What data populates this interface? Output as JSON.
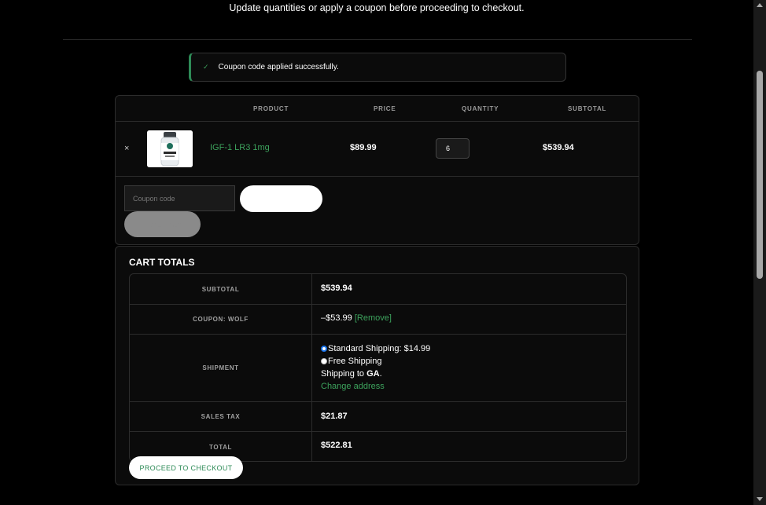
{
  "intro_text": "Update quantities or apply a coupon before proceeding to checkout.",
  "notice": {
    "text": "Coupon code applied successfully.",
    "icon": "check-icon",
    "accent_color": "#2e8b57"
  },
  "cart": {
    "headers": {
      "product": "PRODUCT",
      "price": "PRICE",
      "quantity": "QUANTITY",
      "subtotal": "SUBTOTAL"
    },
    "item": {
      "remove_symbol": "×",
      "name": "IGF-1 LR3 1mg",
      "price": "$89.99",
      "quantity": "6",
      "subtotal": "$539.94"
    },
    "coupon_placeholder": "Coupon code",
    "apply_label": "Apply coupon",
    "update_label": "Update cart"
  },
  "totals": {
    "title": "CART TOTALS",
    "subtotal_label": "SUBTOTAL",
    "subtotal_value": "$539.94",
    "coupon_label": "COUPON: WOLF",
    "coupon_value": "–$53.99",
    "coupon_remove": "[Remove]",
    "shipment_label": "SHIPMENT",
    "shipping_standard": "Standard Shipping: $14.99",
    "shipping_free": "Free Shipping",
    "shipping_to_prefix": "Shipping to ",
    "shipping_to_state": "GA",
    "shipping_to_suffix": ".",
    "change_address": "Change address",
    "tax_label": "SALES TAX",
    "tax_value": "$21.87",
    "total_label": "TOTAL",
    "total_value": "$522.81",
    "checkout_label": "PROCEED TO CHECKOUT"
  },
  "colors": {
    "background": "#000000",
    "panel": "#0b0b0b",
    "accent_green": "#3da35d"
  }
}
